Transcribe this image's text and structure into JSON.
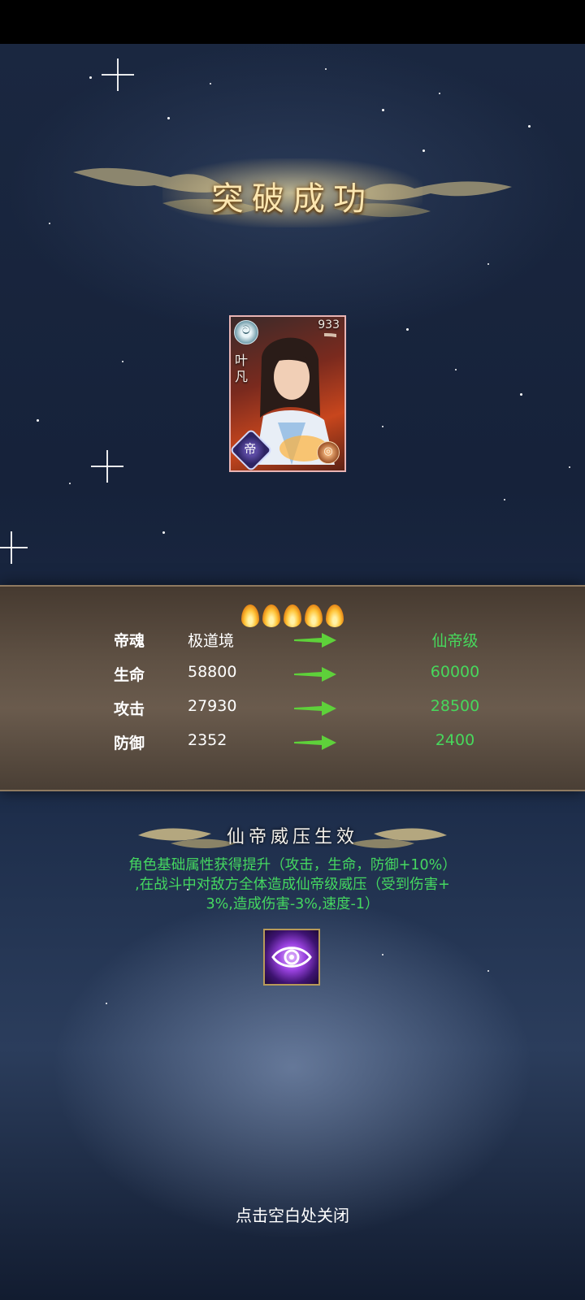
{
  "title": "突破成功",
  "hero": {
    "level": "933",
    "name": "叶凡",
    "badge_top_icon": "swirl-icon",
    "badge_rank": "帝",
    "badge_element_icon": "fire-element-icon"
  },
  "flames_count": 5,
  "stats": [
    {
      "label": "帝魂",
      "old": "极道境",
      "new": "仙帝级"
    },
    {
      "label": "生命",
      "old": "58800",
      "new": "60000"
    },
    {
      "label": "攻击",
      "old": "27930",
      "new": "28500"
    },
    {
      "label": "防御",
      "old": "2352",
      "new": "2400"
    }
  ],
  "effect": {
    "title": "仙帝威压生效",
    "line1": "角色基础属性获得提升（攻击，生命，防御+10%）",
    "line2": ",在战斗中对敌方全体造成仙帝级威压（受到伤害+",
    "line3": "3%,造成伤害-3%,速度-1）",
    "skill_icon": "purple-eye-icon"
  },
  "close_hint": "点击空白处关闭",
  "colors": {
    "new_value": "#47d85c",
    "title_gold": "#fbe6b0",
    "panel_brown": "#5e5043"
  }
}
